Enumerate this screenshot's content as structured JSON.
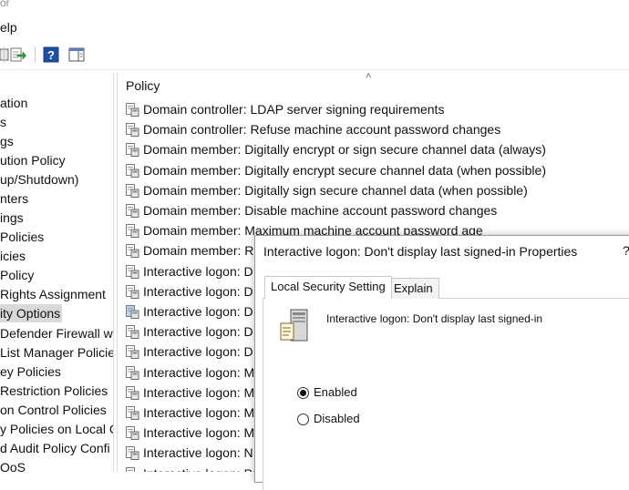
{
  "window": {
    "title_fragment": "or",
    "menu_fragment": "elp"
  },
  "toolbar": {
    "icons": [
      "export-list-icon",
      "help-icon",
      "show-hide-action-pane-icon"
    ]
  },
  "tree": {
    "items": [
      {
        "label": "ation"
      },
      {
        "label": "s"
      },
      {
        "label": "gs"
      },
      {
        "label": "ution Policy"
      },
      {
        "label": "up/Shutdown)"
      },
      {
        "label": "nters"
      },
      {
        "label": "ings"
      },
      {
        "label": " Policies"
      },
      {
        "label": "icies"
      },
      {
        "label": " Policy"
      },
      {
        "label": "Rights Assignment"
      },
      {
        "label": "ity Options",
        "selected": true
      },
      {
        "label": "Defender Firewall w"
      },
      {
        "label": "List Manager Policie"
      },
      {
        "label": "ey Policies"
      },
      {
        "label": "Restriction Policies"
      },
      {
        "label": "on Control Policies"
      },
      {
        "label": "y Policies on Local C"
      },
      {
        "label": "d Audit Policy Confi"
      },
      {
        "label": "QoS"
      }
    ]
  },
  "list": {
    "column_header": "Policy",
    "rows": [
      {
        "label": "Domain controller: LDAP server signing requirements"
      },
      {
        "label": "Domain controller: Refuse machine account password changes"
      },
      {
        "label": "Domain member: Digitally encrypt or sign secure channel data (always)"
      },
      {
        "label": "Domain member: Digitally encrypt secure channel data (when possible)"
      },
      {
        "label": "Domain member: Digitally sign secure channel data (when possible)"
      },
      {
        "label": "Domain member: Disable machine account password changes"
      },
      {
        "label": "Domain member: Maximum machine account password age"
      },
      {
        "label": "Domain member: R"
      },
      {
        "label": "Interactive logon: D"
      },
      {
        "label": "Interactive logon: D"
      },
      {
        "label": "Interactive logon: D"
      },
      {
        "label": "Interactive logon: D"
      },
      {
        "label": "Interactive logon: D"
      },
      {
        "label": "Interactive logon: M"
      },
      {
        "label": "Interactive logon: M"
      },
      {
        "label": "Interactive logon: M"
      },
      {
        "label": "Interactive logon: M"
      },
      {
        "label": "Interactive logon: N"
      },
      {
        "label": "Interactive logon: Pr"
      },
      {
        "label": ""
      }
    ]
  },
  "dialog": {
    "title": "Interactive logon: Don't display last signed-in Properties",
    "help_symbol": "?",
    "tabs": [
      {
        "label": "Local Security Setting",
        "active": true
      },
      {
        "label": "Explain",
        "active": false
      }
    ],
    "policy_name": "Interactive logon: Don't display last signed-in",
    "options": [
      {
        "label": "Enabled",
        "checked": true
      },
      {
        "label": "Disabled",
        "checked": false
      }
    ]
  },
  "colors": {
    "selection": "#d9d9d9",
    "help_icon_blue": "#1f4fa5",
    "export_icon_green": "#3a9a3a"
  }
}
